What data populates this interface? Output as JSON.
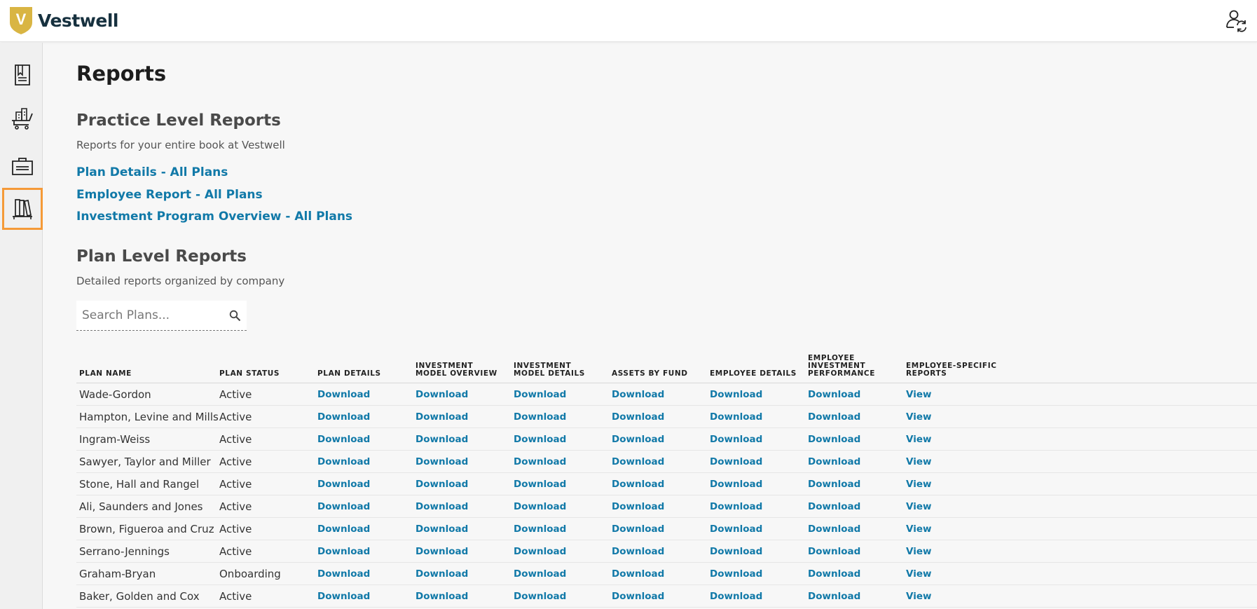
{
  "app": {
    "brand": "Vestwell",
    "logo_letter": "V",
    "accent": "#1179a8",
    "highlight": "#f59a38",
    "logo_gold": "#d9b543"
  },
  "header": {
    "user_icon": "user-switch-icon"
  },
  "sidebar": {
    "items": [
      {
        "icon": "document-list-icon",
        "active": false
      },
      {
        "icon": "buildings-cart-icon",
        "active": false
      },
      {
        "icon": "briefcase-icon",
        "active": false
      },
      {
        "icon": "library-books-icon",
        "active": true
      }
    ]
  },
  "page": {
    "title": "Reports"
  },
  "practice": {
    "title": "Practice Level Reports",
    "description": "Reports for your entire book at Vestwell",
    "links": [
      "Plan Details - All Plans",
      "Employee Report - All Plans",
      "Investment Program Overview - All Plans"
    ]
  },
  "plan_level": {
    "title": "Plan Level Reports",
    "description": "Detailed reports organized by company",
    "search": {
      "placeholder": "Search Plans...",
      "value": ""
    }
  },
  "table": {
    "headers": [
      "PLAN NAME",
      "PLAN STATUS",
      "PLAN DETAILS",
      "INVESTMENT MODEL OVERVIEW",
      "INVESTMENT MODEL DETAILS",
      "ASSETS BY FUND",
      "EMPLOYEE DETAILS",
      "EMPLOYEE INVESTMENT PERFORMANCE",
      "EMPLOYEE-SPECIFIC REPORTS"
    ],
    "rows": [
      {
        "name": "Wade-Gordon",
        "status": "Active"
      },
      {
        "name": "Hampton, Levine and Mills",
        "status": "Active"
      },
      {
        "name": "Ingram-Weiss",
        "status": "Active"
      },
      {
        "name": "Sawyer, Taylor and Miller",
        "status": "Active"
      },
      {
        "name": "Stone, Hall and Rangel",
        "status": "Active"
      },
      {
        "name": "Ali, Saunders and Jones",
        "status": "Active"
      },
      {
        "name": "Brown, Figueroa and Cruz",
        "status": "Active"
      },
      {
        "name": "Serrano-Jennings",
        "status": "Active"
      },
      {
        "name": "Graham-Bryan",
        "status": "Onboarding"
      },
      {
        "name": "Baker, Golden and Cox",
        "status": "Active"
      }
    ],
    "download_label": "Download",
    "view_label": "View"
  }
}
